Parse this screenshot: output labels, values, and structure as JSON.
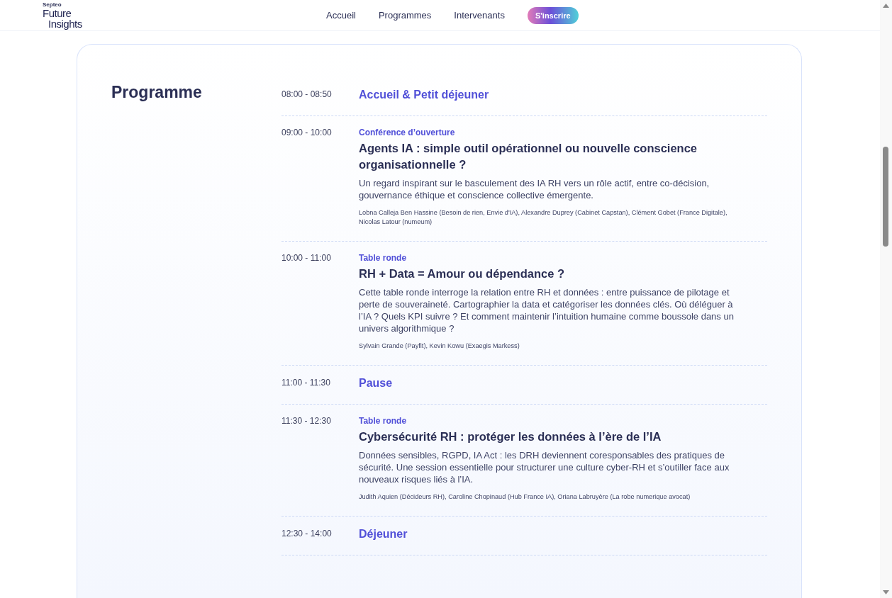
{
  "header": {
    "logo": {
      "brand": "Septeo",
      "line_1": "Future",
      "line_2": "Insights"
    },
    "nav": [
      {
        "label": "Accueil"
      },
      {
        "label": "Programmes"
      },
      {
        "label": "Intervenants"
      }
    ],
    "cta": "S'inscrire"
  },
  "programme": {
    "title": "Programme",
    "sessions": [
      {
        "kind": "break",
        "time": "08:00 - 08:50",
        "title": "Accueil & Petit déjeuner"
      },
      {
        "kind": "talk",
        "time": "09:00 - 10:00",
        "category": "Conférence d’ouverture",
        "title": "Agents IA : simple outil opérationnel ou nouvelle conscience organisationnelle ?",
        "description": "Un regard inspirant sur le basculement des IA RH vers un rôle actif, entre co-décision, gouvernance éthique et conscience collective émergente.",
        "speakers": "Lobna Calleja Ben Hassine (Besoin de rien, Envie d'IA), Alexandre Duprey (Cabinet Capstan), Clément Gobet (France Digitale), Nicolas Latour (numeum)"
      },
      {
        "kind": "talk",
        "time": "10:00 - 11:00",
        "category": "Table ronde",
        "title": "RH + Data = Amour ou dépendance ?",
        "description": "Cette table ronde interroge la relation entre RH et données : entre puissance de pilotage et perte de souveraineté. Cartographier la data et catégoriser les données clés. Où déléguer à l’IA ? Quels KPI suivre ? Et comment maintenir l’intuition humaine comme boussole dans un univers algorithmique ?",
        "speakers": "Sylvain Grande (Payfit), Kevin Kowu (Exaegis Markess)"
      },
      {
        "kind": "break",
        "time": "11:00 - 11:30",
        "title": "Pause"
      },
      {
        "kind": "talk",
        "time": "11:30 - 12:30",
        "category": "Table ronde",
        "title": "Cybersécurité RH : protéger les données à l’ère de l’IA",
        "description": "Données sensibles, RGPD, IA Act : les DRH deviennent coresponsables des pratiques de sécurité. Une session essentielle pour structurer une culture cyber-RH et s’outiller face aux nouveaux risques liés à l’IA.",
        "speakers": "Judith Aquien (Décideurs RH), Caroline Chopinaud (Hub France IA), Oriana Labruyère (La robe numerique avocat)"
      },
      {
        "kind": "break",
        "time": "12:30 - 14:00",
        "title": "Déjeuner"
      }
    ]
  }
}
